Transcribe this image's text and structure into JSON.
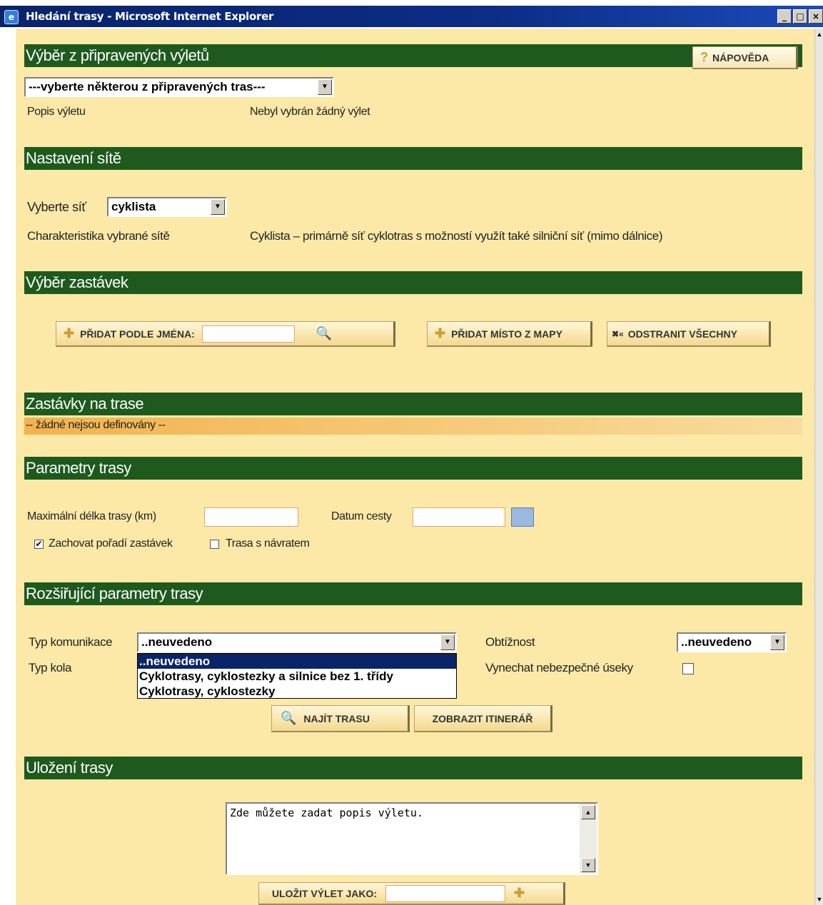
{
  "window": {
    "title": "Hledání trasy - Microsoft Internet Explorer"
  },
  "section_trips": {
    "header": "Výběr z připravených výletů",
    "help_button": "NÁPOVĚDA",
    "trip_select": "---vyberte některou z připravených tras---",
    "desc_label": "Popis výletu",
    "desc_value": "Nebyl vybrán žádný výlet"
  },
  "section_network": {
    "header": "Nastavení sítě",
    "select_label": "Vyberte síť",
    "select_value": "cyklista",
    "char_label": "Charakteristika vybrané sítě",
    "char_value": "Cyklista – primárně síť cyklotras s možností využít také silniční síť (mimo dálnice)"
  },
  "section_stops": {
    "header": "Výběr zastávek",
    "add_by_name": "PŘIDAT PODLE JMÉNA:",
    "add_from_map": "PŘIDAT MÍSTO Z MAPY",
    "remove_all": "ODSTRANIT VŠECHNY"
  },
  "section_route_stops": {
    "header": "Zastávky na trase",
    "empty_text": "-- žádné nejsou definovány --"
  },
  "section_params": {
    "header": "Parametry trasy",
    "max_length_label": "Maximální délka trasy (km)",
    "date_label": "Datum cesty",
    "keep_order_label": "Zachovat pořadí zastávek",
    "keep_order_checked": true,
    "round_trip_label": "Trasa s návratem",
    "round_trip_checked": false
  },
  "section_ext": {
    "header": "Rozšiřující parametry trasy",
    "road_type_label": "Typ komunikace",
    "road_type_value": "..neuvedeno",
    "road_type_options": [
      "..neuvedeno",
      "Cyklotrasy, cyklostezky a silnice bez 1. třídy",
      "Cyklotrasy, cyklostezky"
    ],
    "bike_type_label": "Typ kola",
    "difficulty_label": "Obtížnost",
    "difficulty_value": "..neuvedeno",
    "skip_dangerous_label": "Vynechat nebezpečné úseky",
    "find_route": "NAJÍT TRASU",
    "show_itinerary": "ZOBRAZIT ITINERÁŘ"
  },
  "section_save": {
    "header": "Uložení trasy",
    "textarea_value": "Zde můžete zadat popis výletu.",
    "save_as": "ULOŽIT VÝLET JAKO:"
  },
  "colors": {
    "header_bg": "#1e5a1e",
    "page_bg": "#fce9a8",
    "button_bg": "#f4d98e",
    "stripe": "#f2b24d"
  }
}
